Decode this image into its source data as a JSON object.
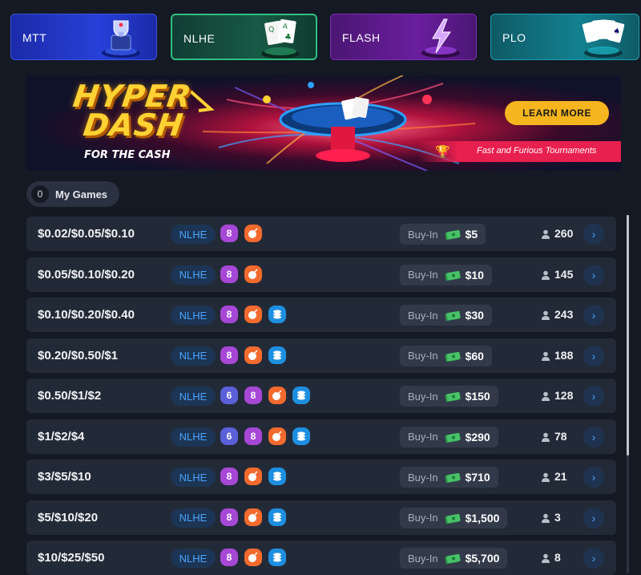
{
  "tabs": [
    {
      "label": "MTT",
      "icon": "trophy-icon",
      "active": false
    },
    {
      "label": "NLHE",
      "icon": "cards-qa-icon",
      "active": true
    },
    {
      "label": "FLASH",
      "icon": "lightning-icon",
      "active": false
    },
    {
      "label": "PLO",
      "icon": "cards-kaqk-icon",
      "active": false
    }
  ],
  "banner": {
    "title_line1": "HYPER",
    "title_line2": "DASH",
    "subtitle": "FOR THE CASH",
    "cta": "LEARN MORE",
    "tagline": "Fast and Furious Tournaments"
  },
  "my_games": {
    "count": "0",
    "label": "My Games"
  },
  "buyin_label": "Buy-In",
  "colors": {
    "accent": "#4aa3ff",
    "row_bg": "#232a37",
    "purple": "#a647d6",
    "indigo": "#5b5fd8",
    "orange": "#f26a2e",
    "blue": "#1d8fe0"
  },
  "tables": [
    {
      "stakes": "$0.02/$0.05/$0.10",
      "game": "NLHE",
      "features": [
        "8",
        "bomb"
      ],
      "buyin": "$5",
      "players": "260"
    },
    {
      "stakes": "$0.05/$0.10/$0.20",
      "game": "NLHE",
      "features": [
        "8",
        "bomb"
      ],
      "buyin": "$10",
      "players": "145"
    },
    {
      "stakes": "$0.10/$0.20/$0.40",
      "game": "NLHE",
      "features": [
        "8",
        "bomb",
        "coins"
      ],
      "buyin": "$30",
      "players": "243"
    },
    {
      "stakes": "$0.20/$0.50/$1",
      "game": "NLHE",
      "features": [
        "8",
        "bomb",
        "coins"
      ],
      "buyin": "$60",
      "players": "188"
    },
    {
      "stakes": "$0.50/$1/$2",
      "game": "NLHE",
      "features": [
        "6",
        "8",
        "bomb",
        "coins"
      ],
      "buyin": "$150",
      "players": "128"
    },
    {
      "stakes": "$1/$2/$4",
      "game": "NLHE",
      "features": [
        "6",
        "8",
        "bomb",
        "coins"
      ],
      "buyin": "$290",
      "players": "78"
    },
    {
      "stakes": "$3/$5/$10",
      "game": "NLHE",
      "features": [
        "8",
        "bomb",
        "coins"
      ],
      "buyin": "$710",
      "players": "21"
    },
    {
      "stakes": "$5/$10/$20",
      "game": "NLHE",
      "features": [
        "8",
        "bomb",
        "coins"
      ],
      "buyin": "$1,500",
      "players": "3"
    },
    {
      "stakes": "$10/$25/$50",
      "game": "NLHE",
      "features": [
        "8",
        "bomb",
        "coins"
      ],
      "buyin": "$5,700",
      "players": "8"
    }
  ]
}
